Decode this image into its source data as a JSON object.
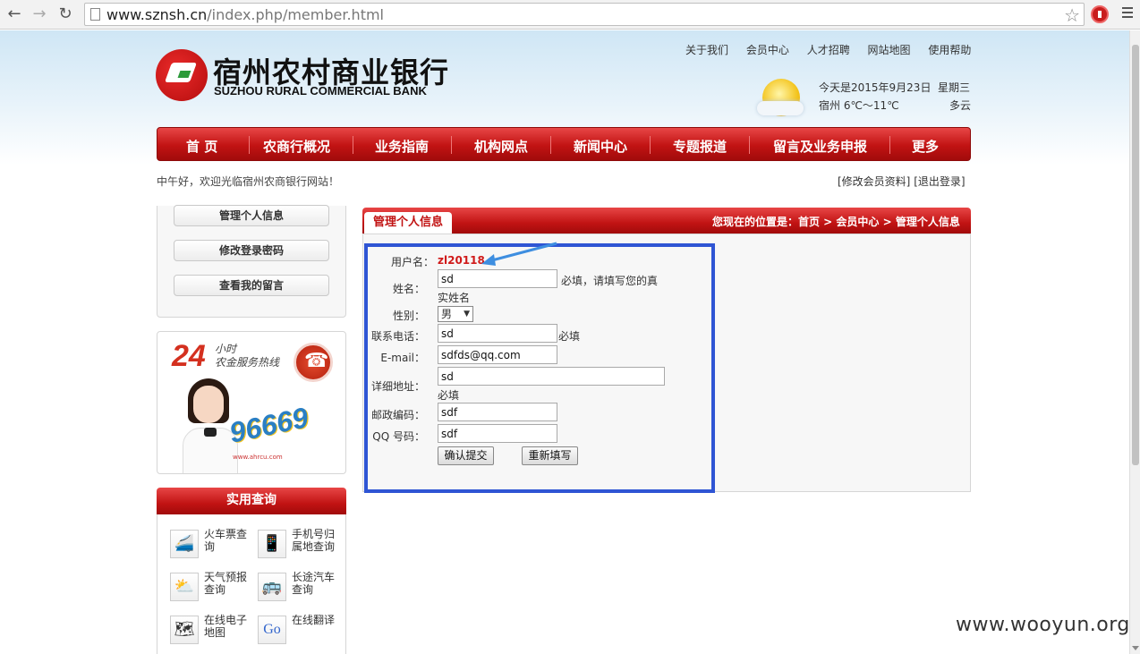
{
  "browser": {
    "url_host": "www.sznsh.cn",
    "url_path": "/index.php/member.html"
  },
  "header": {
    "bank_name_cn": "宿州农村商业银行",
    "bank_name_en": "SUZHOU RURAL COMMERCIAL BANK",
    "top_links": [
      "关于我们",
      "会员中心",
      "人才招聘",
      "网站地图",
      "使用帮助"
    ],
    "weather": {
      "date_text": "今天是2015年9月23日",
      "weekday": "星期三",
      "location_temp": "宿州 6℃～11℃",
      "condition": "多云"
    }
  },
  "nav": [
    "首 页",
    "农商行概况",
    "业务指南",
    "机构网点",
    "新闻中心",
    "专题报道",
    "留言及业务申报",
    "更多"
  ],
  "welcome": "中午好，欢迎光临宿州农商银行网站！",
  "member_links": {
    "edit": "[修改会员资料]",
    "logout": "[退出登录]"
  },
  "sidebar": {
    "buttons": [
      "管理个人信息",
      "修改登录密码",
      "查看我的留言"
    ],
    "ad": {
      "hours": "24",
      "line1": "小时",
      "line2": "农金服务热线",
      "number": "96669",
      "url": "www.ahrcu.com"
    },
    "query_title": "实用查询",
    "query_items": [
      {
        "label": "火车票查询",
        "icon": "train-icon"
      },
      {
        "label": "手机号归属地查询",
        "icon": "mobile-icon"
      },
      {
        "label": "天气预报查询",
        "icon": "weather-icon"
      },
      {
        "label": "长途汽车查询",
        "icon": "bus-icon"
      },
      {
        "label": "在线电子地图",
        "icon": "map-icon"
      },
      {
        "label": "在线翻译",
        "icon": "google-icon"
      }
    ]
  },
  "main": {
    "tab_title": "管理个人信息",
    "breadcrumb": "您现在的位置是：首页 > 会员中心 > 管理个人信息",
    "form": {
      "username_label": "用户名：",
      "username_value": "zl20118",
      "name_label": "姓名：",
      "name_value": "sd",
      "name_note_1": "必填，请填写您的真",
      "name_note_2": "实姓名",
      "gender_label": "性别：",
      "gender_value": "男",
      "phone_label": "联系电话：",
      "phone_value": "sd",
      "phone_note": "必填",
      "email_label": "E-mail：",
      "email_value": "sdfds@qq.com",
      "address_label": "详细地址：",
      "address_value": "sd",
      "address_note": "必填",
      "zip_label": "邮政编码：",
      "zip_value": "sdf",
      "qq_label": "QQ 号码：",
      "qq_value": "sdf",
      "submit_label": "确认提交",
      "reset_label": "重新填写"
    }
  },
  "watermark": "www.wooyun.org",
  "colors": {
    "brand_red": "#c11313",
    "highlight_blue": "#2f55d4",
    "username_red": "#d01a1a"
  }
}
